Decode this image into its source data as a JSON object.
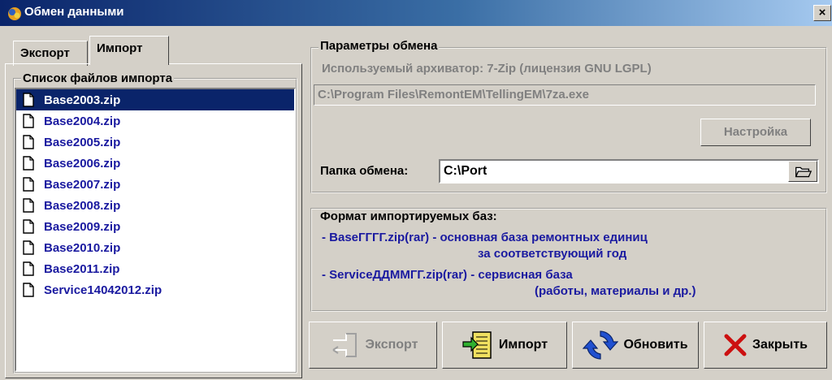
{
  "window": {
    "title": "Обмен данными",
    "close_glyph": "×"
  },
  "tabs": [
    {
      "label": "Экспорт"
    },
    {
      "label": "Импорт"
    }
  ],
  "files": {
    "group_label": "Список файлов импорта",
    "items": [
      {
        "name": "Base2003.zip"
      },
      {
        "name": "Base2004.zip"
      },
      {
        "name": "Base2005.zip"
      },
      {
        "name": "Base2006.zip"
      },
      {
        "name": "Base2007.zip"
      },
      {
        "name": "Base2008.zip"
      },
      {
        "name": "Base2009.zip"
      },
      {
        "name": "Base2010.zip"
      },
      {
        "name": "Base2011.zip"
      },
      {
        "name": "Service14042012.zip"
      }
    ],
    "selected_index": 0
  },
  "params": {
    "group_label": "Параметры обмена",
    "archiver_label": "Используемый архиватор: 7-Zip (лицензия GNU LGPL)",
    "archiver_path": "C:\\Program Files\\RemontEM\\TellingEM\\7za.exe",
    "settings_button": "Настройка",
    "folder_label": "Папка обмена:",
    "folder_value": "C:\\Port"
  },
  "format": {
    "group_label": "Формат импортируемых баз:",
    "line1": "- BaseГГГГ.zip(rar) - основная база ремонтных единиц",
    "line2": "за соответствующий год",
    "line3": "- ServiceДДММГГ.zip(rar) - сервисная база",
    "line4": "(работы, материалы и др.)"
  },
  "buttons": {
    "export": "Экспорт",
    "import": "Импорт",
    "refresh": "Обновить",
    "close": "Закрыть"
  },
  "colors": {
    "titlebar": "#0a246a",
    "selection": "#0a246a",
    "link_text": "#1a1aa0",
    "window_bg": "#d4d0c8",
    "close_x": "#cc1010"
  }
}
